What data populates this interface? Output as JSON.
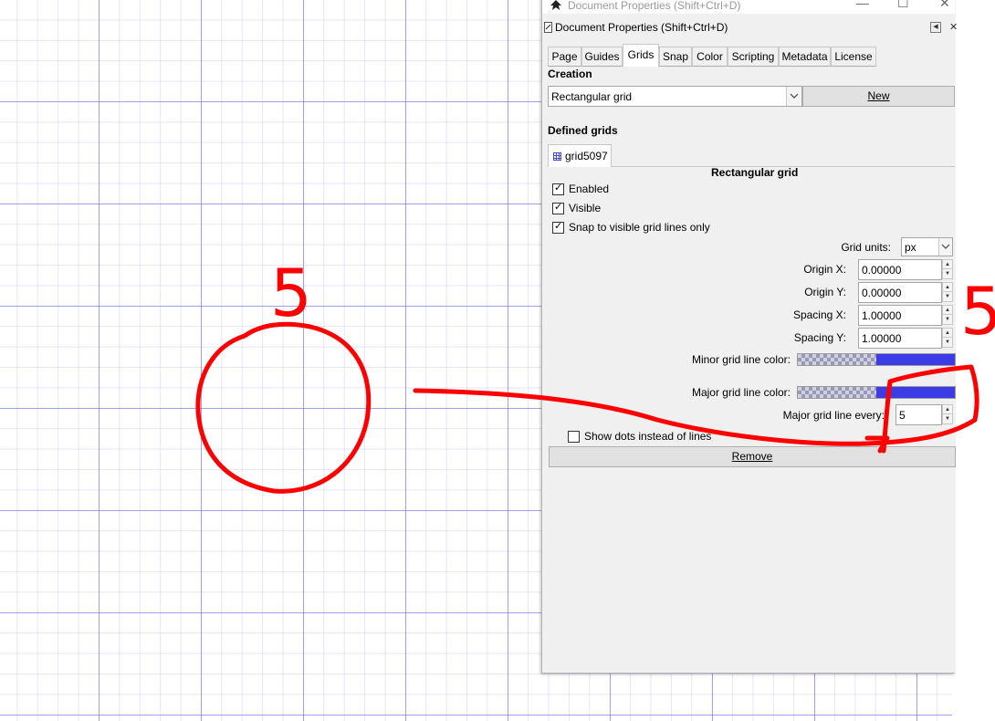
{
  "window": {
    "title": "Document Properties (Shift+Ctrl+D)",
    "dock_title": "Document Properties (Shift+Ctrl+D)",
    "buttons": {
      "minimize": "—",
      "maximize": "☐",
      "close": "✕"
    }
  },
  "tabs": [
    {
      "label": "Page"
    },
    {
      "label": "Guides"
    },
    {
      "label": "Grids",
      "active": true
    },
    {
      "label": "Snap"
    },
    {
      "label": "Color"
    },
    {
      "label": "Scripting"
    },
    {
      "label": "Metadata"
    },
    {
      "label": "License"
    }
  ],
  "creation": {
    "heading": "Creation",
    "grid_type": "Rectangular grid",
    "new_button": "New"
  },
  "defined": {
    "heading": "Defined grids",
    "grid_tab": "grid5097",
    "panel_title": "Rectangular grid",
    "enabled_label": "Enabled",
    "visible_label": "Visible",
    "snap_label": "Snap to visible grid lines only",
    "grid_units_label": "Grid units:",
    "grid_units_value": "px",
    "origin_x_label": "Origin X:",
    "origin_x_value": "0.00000",
    "origin_y_label": "Origin Y:",
    "origin_y_value": "0.00000",
    "spacing_x_label": "Spacing X:",
    "spacing_x_value": "1.00000",
    "spacing_y_label": "Spacing Y:",
    "spacing_y_value": "1.00000",
    "minor_color_label": "Minor grid line color:",
    "major_color_label": "Major grid line color:",
    "major_every_label": "Major grid line every:",
    "major_every_value": "5",
    "show_dots_label": "Show dots instead of lines",
    "remove_button": "Remove"
  },
  "colors": {
    "grid_line": "#3c3ce6",
    "annotation": "#ff0000"
  },
  "annotations": {
    "top_number": "5",
    "right_number": "5"
  }
}
